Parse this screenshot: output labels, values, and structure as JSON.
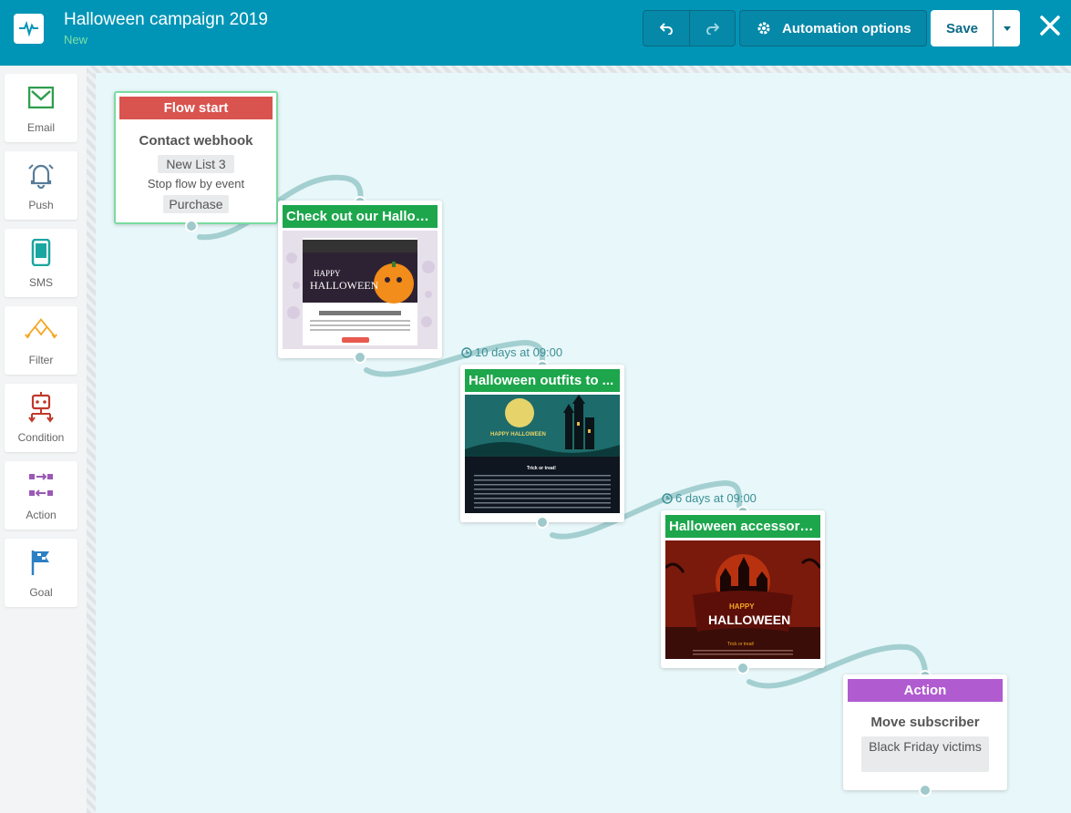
{
  "header": {
    "title": "Halloween campaign 2019",
    "status": "New",
    "automation_options": "Automation options",
    "save": "Save"
  },
  "sidebar": {
    "items": [
      {
        "label": "Email",
        "icon": "email-icon"
      },
      {
        "label": "Push",
        "icon": "bell-icon"
      },
      {
        "label": "SMS",
        "icon": "phone-icon"
      },
      {
        "label": "Filter",
        "icon": "filter-icon"
      },
      {
        "label": "Condition",
        "icon": "condition-icon"
      },
      {
        "label": "Action",
        "icon": "action-icon"
      },
      {
        "label": "Goal",
        "icon": "flag-icon"
      }
    ]
  },
  "flow": {
    "start": {
      "header": "Flow start",
      "trigger": "Contact webhook",
      "list": "New List 3",
      "stop_label": "Stop flow by event",
      "stop_event": "Purchase"
    },
    "emails": [
      {
        "title": "Check out our Hallow...",
        "wait": ""
      },
      {
        "title": "Halloween outfits to ...",
        "wait": "10 days at 09:00"
      },
      {
        "title": "Halloween accessories",
        "wait": "6 days at 09:00"
      }
    ],
    "action": {
      "header": "Action",
      "title": "Move subscriber",
      "target": "Black Friday victims"
    }
  },
  "colors": {
    "header_bg": "#0095b6",
    "flow_start": "#d9534f",
    "email": "#1da64c",
    "action": "#b15bd0",
    "canvas_bg": "#e8f7f9"
  }
}
